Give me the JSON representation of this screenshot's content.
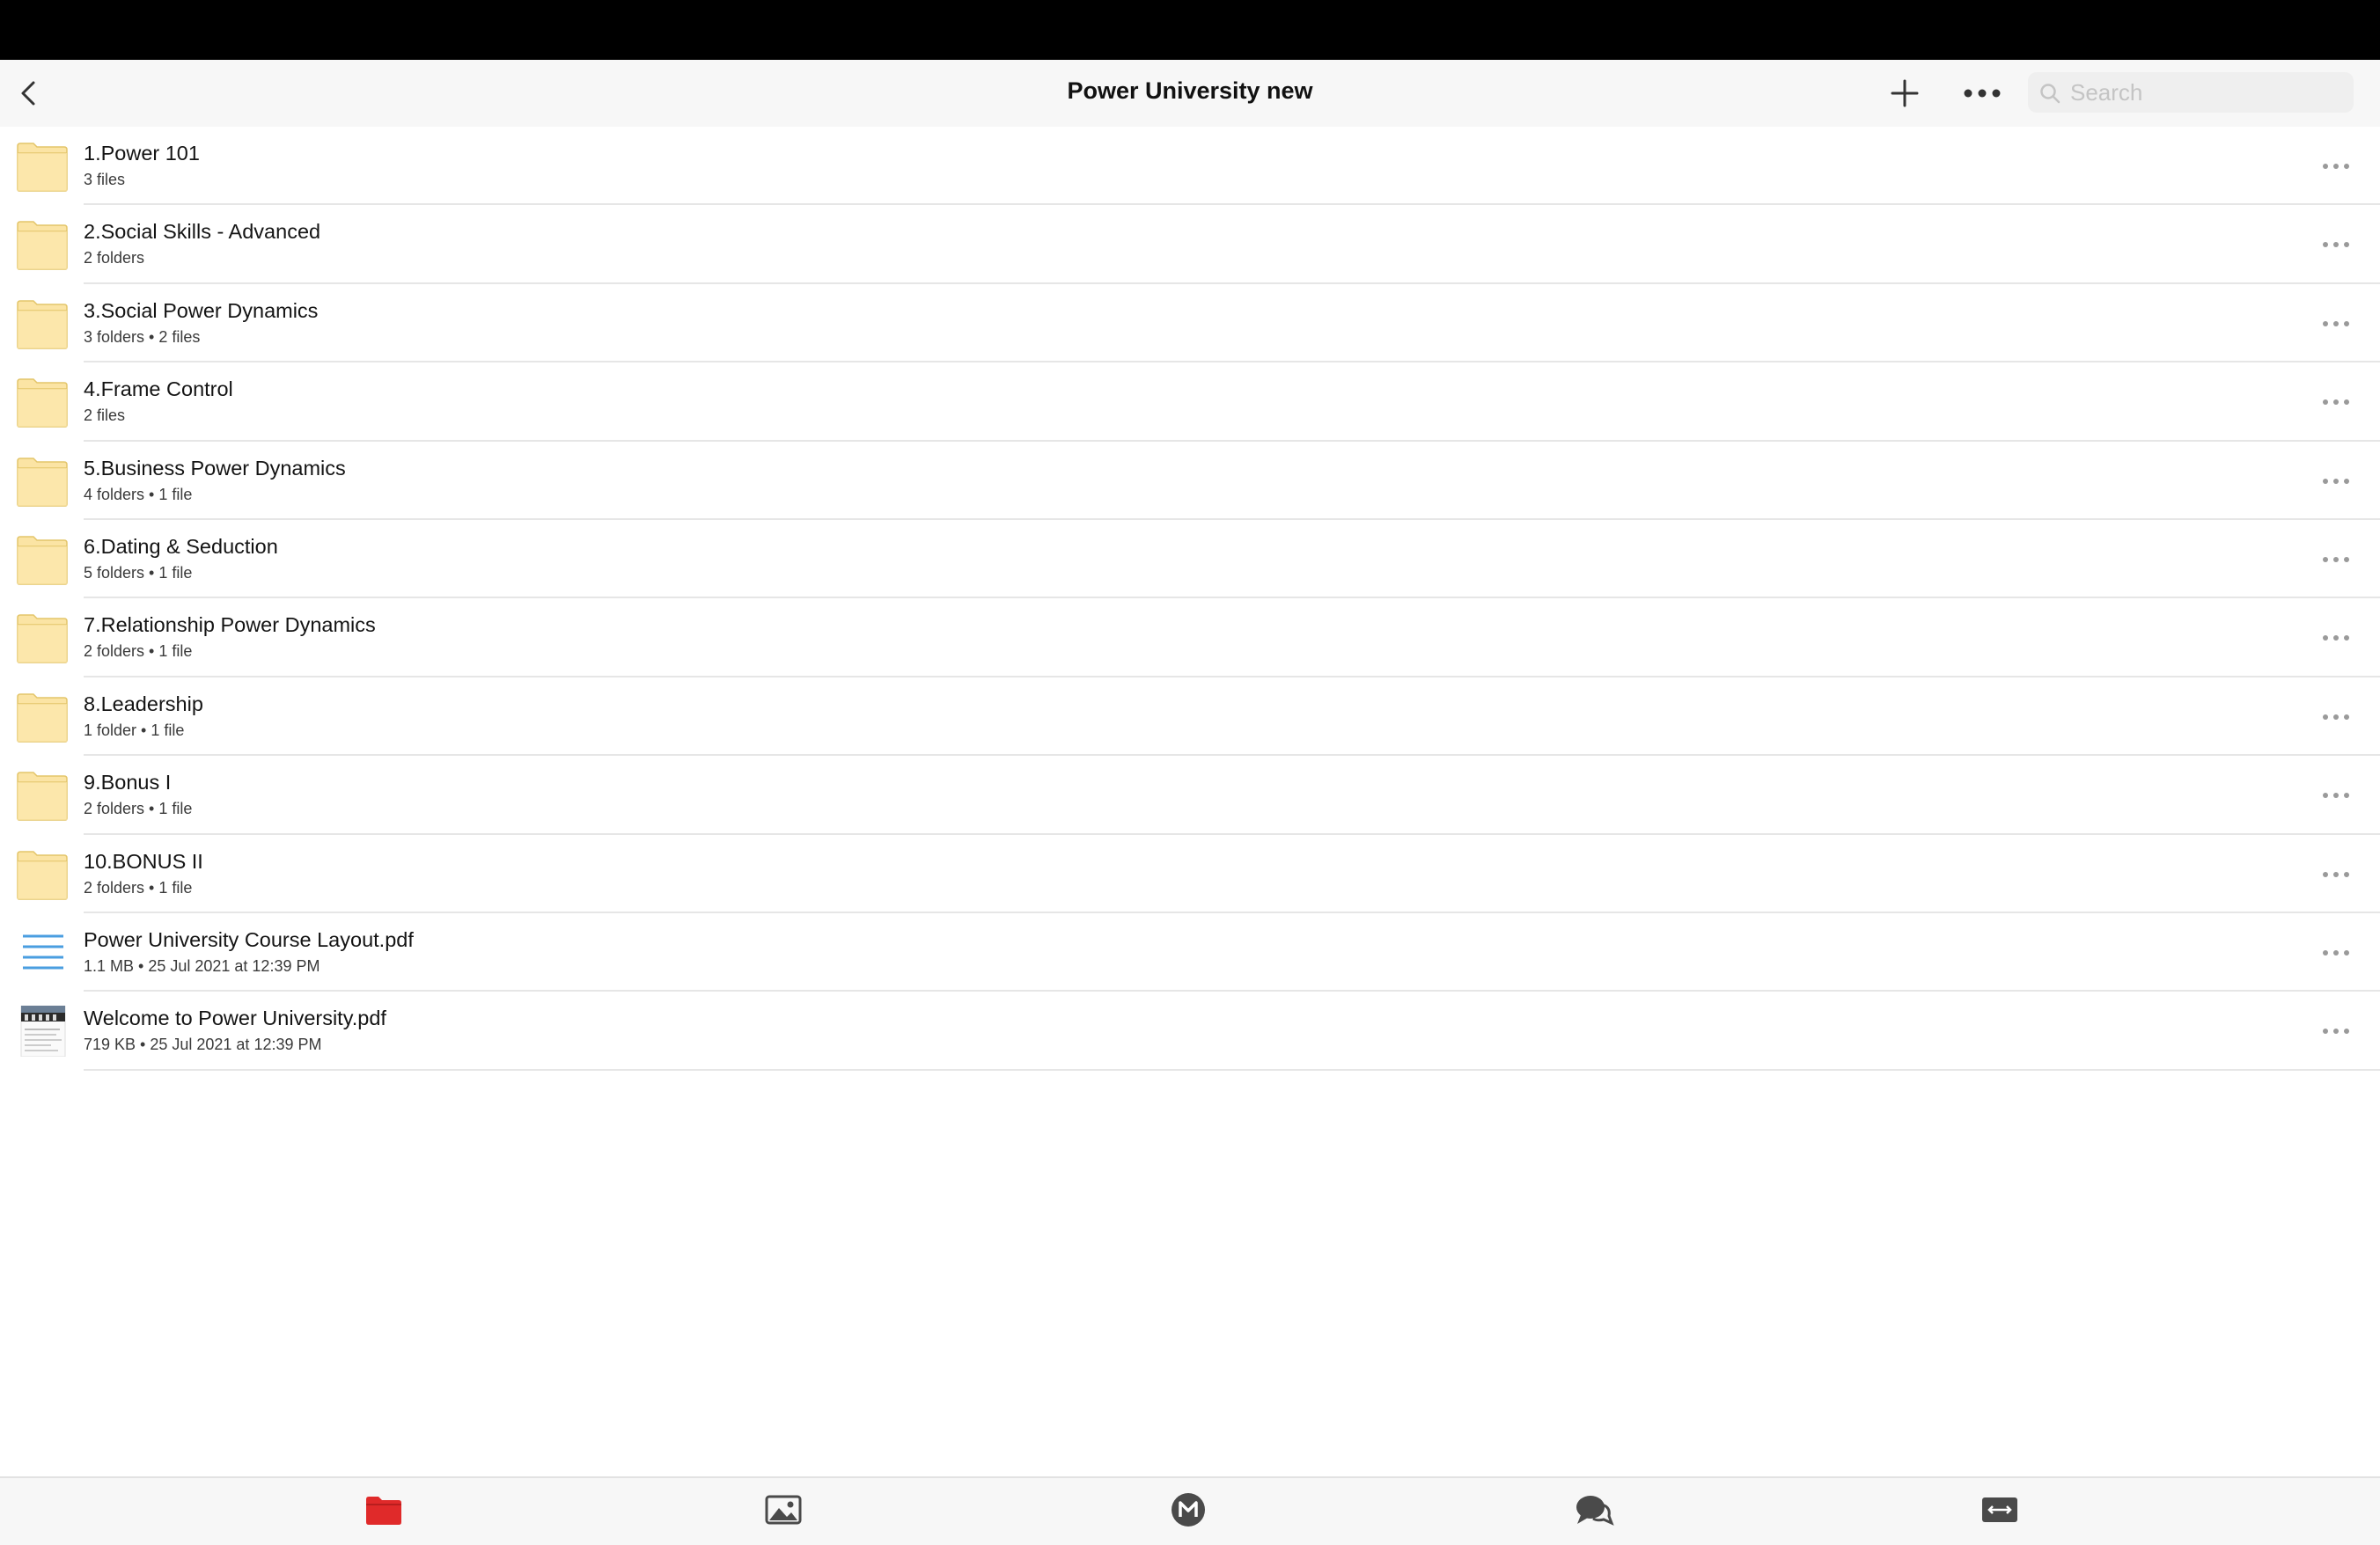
{
  "header": {
    "title": "Power University new",
    "search_placeholder": "Search"
  },
  "items": [
    {
      "type": "folder",
      "name": "1.Power 101",
      "meta": "3 files"
    },
    {
      "type": "folder",
      "name": "2.Social Skills - Advanced",
      "meta": "2 folders"
    },
    {
      "type": "folder",
      "name": "3.Social Power Dynamics",
      "meta": "3 folders • 2 files"
    },
    {
      "type": "folder",
      "name": "4.Frame Control",
      "meta": "2 files"
    },
    {
      "type": "folder",
      "name": "5.Business Power Dynamics",
      "meta": "4 folders • 1 file"
    },
    {
      "type": "folder",
      "name": "6.Dating & Seduction",
      "meta": "5 folders • 1 file"
    },
    {
      "type": "folder",
      "name": "7.Relationship Power Dynamics",
      "meta": "2 folders • 1 file"
    },
    {
      "type": "folder",
      "name": "8.Leadership",
      "meta": "1 folder • 1 file"
    },
    {
      "type": "folder",
      "name": "9.Bonus I",
      "meta": "2 folders • 1 file"
    },
    {
      "type": "folder",
      "name": "10.BONUS II",
      "meta": "2 folders • 1 file"
    },
    {
      "type": "document",
      "name": "Power University Course Layout.pdf",
      "meta": "1.1 MB • 25 Jul 2021 at 12:39 PM"
    },
    {
      "type": "pdf-thumbnail",
      "name": "Welcome to Power University.pdf",
      "meta": "719 KB • 25 Jul 2021 at 12:39 PM"
    }
  ],
  "tabs": [
    {
      "name": "cloud-drive",
      "icon": "folder-icon",
      "active": true
    },
    {
      "name": "camera-uploads",
      "icon": "photo-icon",
      "active": false
    },
    {
      "name": "home",
      "icon": "mega-logo-icon",
      "active": false
    },
    {
      "name": "chat",
      "icon": "chat-icon",
      "active": false
    },
    {
      "name": "transfers",
      "icon": "transfers-icon",
      "active": false
    }
  ],
  "colors": {
    "accent": "#e02a2a",
    "folder_fill": "#fbe4a4",
    "folder_stroke": "#e3c56a",
    "doc_lines": "#4a9ee0",
    "tab_icon": "#4a4a4a"
  }
}
